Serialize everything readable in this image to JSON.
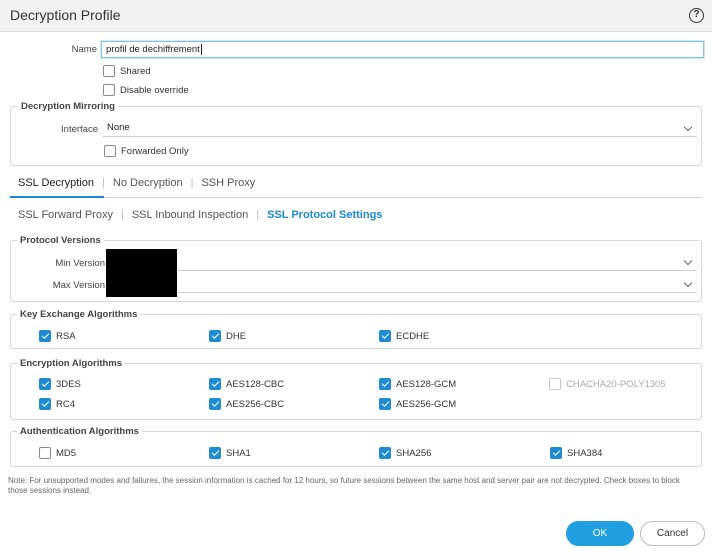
{
  "dialog": {
    "title": "Decryption Profile"
  },
  "general": {
    "name_label": "Name",
    "name_value": "profil de dechiffrement",
    "shared_label": "Shared",
    "disable_override_label": "Disable override"
  },
  "mirroring": {
    "title": "Decryption Mirroring",
    "interface_label": "Interface",
    "interface_value": "None",
    "forwarded_only_label": "Forwarded Only"
  },
  "main_tabs": [
    "SSL Decryption",
    "No Decryption",
    "SSH Proxy"
  ],
  "sub_tabs": [
    "SSL Forward Proxy",
    "SSL Inbound Inspection",
    "SSL Protocol Settings"
  ],
  "protocol_versions": {
    "title": "Protocol Versions",
    "min_label": "Min Version",
    "max_label": "Max Version"
  },
  "key_exchange": {
    "title": "Key Exchange Algorithms",
    "items": [
      {
        "label": "RSA",
        "checked": true
      },
      {
        "label": "DHE",
        "checked": true
      },
      {
        "label": "ECDHE",
        "checked": true
      }
    ]
  },
  "encryption": {
    "title": "Encryption Algorithms",
    "items": [
      {
        "label": "3DES",
        "checked": true
      },
      {
        "label": "AES128-CBC",
        "checked": true
      },
      {
        "label": "AES128-GCM",
        "checked": true
      },
      {
        "label": "CHACHA20-POLY1305",
        "checked": false,
        "disabled": true
      },
      {
        "label": "RC4",
        "checked": true
      },
      {
        "label": "AES256-CBC",
        "checked": true
      },
      {
        "label": "AES256-GCM",
        "checked": true
      }
    ]
  },
  "authentication": {
    "title": "Authentication Algorithms",
    "items": [
      {
        "label": "MD5",
        "checked": false
      },
      {
        "label": "SHA1",
        "checked": true
      },
      {
        "label": "SHA256",
        "checked": true
      },
      {
        "label": "SHA384",
        "checked": true
      }
    ]
  },
  "note": "Note: For unsupported modes and failures, the session information is cached for 12 hours, so future sessions between the same host and server pair are not decrypted. Check boxes to block those sessions instead.",
  "buttons": {
    "ok": "OK",
    "cancel": "Cancel"
  },
  "colors": {
    "accent": "#1f8bd0",
    "primary_button": "#1f9fe0"
  }
}
